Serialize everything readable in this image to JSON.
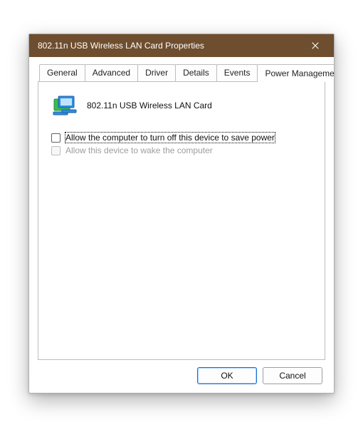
{
  "window": {
    "title": "802.11n USB Wireless LAN Card Properties"
  },
  "tabs": {
    "general": "General",
    "advanced": "Advanced",
    "driver": "Driver",
    "details": "Details",
    "events": "Events",
    "power_management": "Power Management"
  },
  "device": {
    "name": "802.11n USB Wireless LAN Card"
  },
  "options": {
    "allow_off": {
      "label": "Allow the computer to turn off this device to save power",
      "checked": false,
      "focused": true,
      "enabled": true
    },
    "allow_wake": {
      "label": "Allow this device to wake the computer",
      "checked": false,
      "focused": false,
      "enabled": false
    }
  },
  "buttons": {
    "ok": "OK",
    "cancel": "Cancel"
  }
}
